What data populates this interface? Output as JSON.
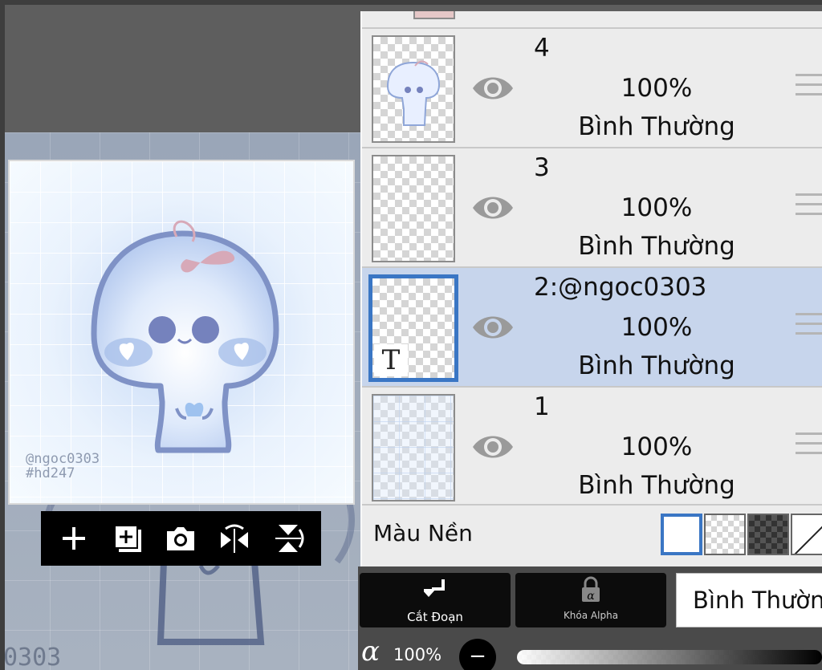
{
  "canvas": {
    "watermark_partial": "0303",
    "preview_signature_line1": "@ngoc0303",
    "preview_signature_line2": "#hd247"
  },
  "preview_toolbar": {
    "add_icon": "plus-icon",
    "add_layer_icon": "add-layer-icon",
    "camera_icon": "camera-icon",
    "flip_horizontal_icon": "flip-horizontal-icon",
    "flip_vertical_icon": "flip-vertical-icon"
  },
  "layers": [
    {
      "name": "4",
      "opacity": "100%",
      "blend": "Bình Thường",
      "visible": true,
      "selected": false
    },
    {
      "name": "3",
      "opacity": "100%",
      "blend": "Bình Thường",
      "visible": true,
      "selected": false
    },
    {
      "name": "2:@ngoc0303",
      "opacity": "100%",
      "blend": "Bình Thường",
      "visible": true,
      "selected": true,
      "type_marker": "T"
    },
    {
      "name": "1",
      "opacity": "100%",
      "blend": "Bình Thường",
      "visible": true,
      "selected": false
    }
  ],
  "background": {
    "label": "Màu Nền",
    "options": [
      "white",
      "transparent",
      "dark-checker",
      "none"
    ],
    "selected": "white"
  },
  "bottom": {
    "clip_label": "Cắt Đoạn",
    "alpha_lock_label": "Khóa Alpha",
    "blend_mode": "Bình Thường",
    "alpha_symbol": "α",
    "opacity": "100%",
    "minus_label": "−"
  },
  "colors": {
    "selected_row": "#c7d5ec",
    "accent": "#3a76c4",
    "panel": "#ececec"
  }
}
